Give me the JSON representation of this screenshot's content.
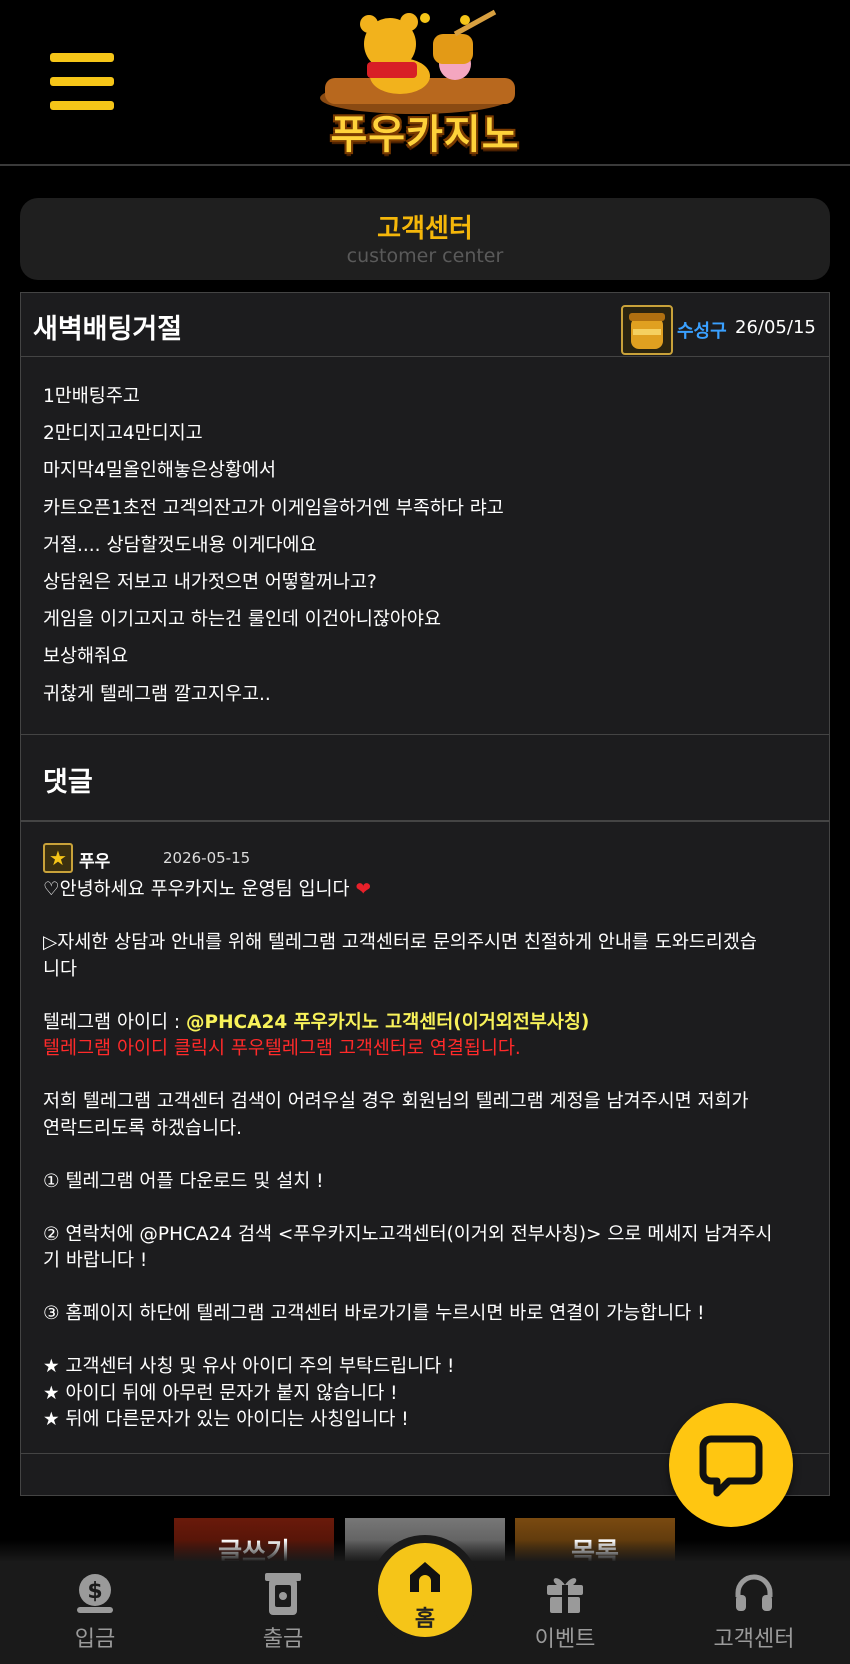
{
  "header": {
    "logo_text": "푸우카지노"
  },
  "page": {
    "title": "고객센터",
    "subtitle": "customer center"
  },
  "post": {
    "title": "새벽배팅거절",
    "author": "수성구",
    "date": "26/05/15",
    "body": [
      "1만배팅주고",
      "2만디지고4만디지고",
      "마지막4밀올인해놓은상황에서",
      "카트오픈1초전 고겍의잔고가 이게임을하거엔 부족하다 랴고",
      "거절.... 상담할껏도내용 이게다에요",
      "상담원은 저보고 내가젓으면 어떻할꺼나고?",
      "게임을 이기고지고 하는건 룰인데 이건아니잖아야요",
      "보상해줘요",
      "귀찮게 텔레그램 깔고지우고.."
    ]
  },
  "comments_section": {
    "title": "댓글"
  },
  "comment": {
    "author": "푸우",
    "date": "2026-05-15",
    "greeting": "♡안녕하세요 푸우카지노 운영팀 입니다",
    "heart": "❤",
    "line1a": "▷자세한 상담과 안내를 위해 텔레그램 고객센터로 문의주시면 친절하게 안내를 도와드리겠습",
    "line1b": "니다",
    "telegram_label": "텔레그램 아이디 : ",
    "telegram_id": "@PHCA24 푸우카지노 고객센터(이거외전부사칭)",
    "telegram_click": "텔레그램 아이디 클릭시 푸우텔레그램 고객센터로 연결됩니다.",
    "line2a": "저희 텔레그램 고객센터 검색이 어려우실 경우 회원님의 텔레그램 계정을 남겨주시면 저희가",
    "line2b": "연락드리도록 하겠습니다.",
    "step1": "① 텔레그램 어플 다운로드 및 설치 !",
    "step2a": "② 연락처에 @PHCA24 검색 <푸우카지노고객센터(이거외 전부사칭)> 으로 메세지 남겨주시",
    "step2b": "기 바랍니다 !",
    "step3": "③ 홈페이지 하단에 텔레그램 고객센터 바로가기를 누르시면 바로 연결이 가능합니다 !",
    "note1": "★ 고객센터 사칭 및 유사 아이디 주의 부탁드립니다 !",
    "note2": "★ 아이디 뒤에 아무런 문자가 붙지 않습니다 !",
    "note3": "★ 뒤에 다른문자가 있는 아이디는 사칭입니다 !"
  },
  "actions": {
    "write": "글쓰기",
    "middle": "",
    "list": "목록"
  },
  "bottom_nav": {
    "deposit": "입금",
    "withdraw": "출금",
    "home": "홈",
    "event": "이벤트",
    "support": "고객센터"
  },
  "colors": {
    "accent": "#f5c518",
    "author_blue": "#3aa0ff",
    "highlight_yellow": "#f8f25a",
    "warning_red": "#ff2a2a"
  },
  "icons": [
    "menu-icon",
    "honey-pot-icon",
    "star-badge-icon",
    "chat-icon",
    "coin-icon",
    "atm-icon",
    "home-icon",
    "gift-icon",
    "headset-icon"
  ]
}
